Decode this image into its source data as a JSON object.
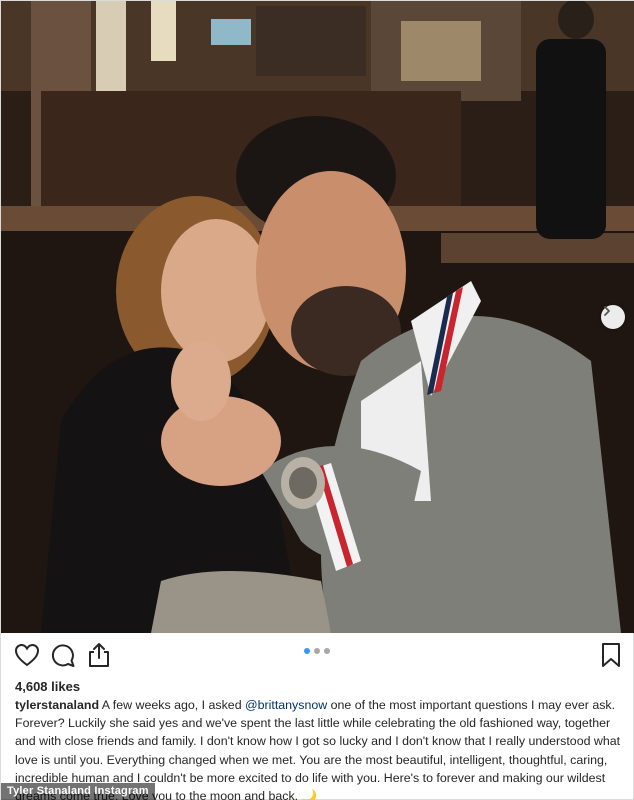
{
  "post": {
    "photo": {
      "alt_subjects": "couple embracing in restaurant booth"
    },
    "carousel": {
      "total": 3,
      "active_index": 0
    },
    "likes_text": "4,608 likes",
    "caption": {
      "username": "tylerstanaland",
      "text_before_mention": " A few weeks ago, I asked ",
      "mention": "@brittanysnow",
      "text_after_mention": " one of the most important questions I may ever ask. Forever? Luckily she said yes and we've spent the last little while celebrating the old fashioned way, together and with close friends and family. I don't know how I got so lucky and I don't know that I really understood what love is until you. Everything changed when we met. You are the most beautiful, intelligent, thoughtful, caring, incredible human and I couldn't be more excited to do life with you. Here's to forever and making our wildest dreams come true. Love you to the moon and back. 🌙"
    },
    "credit": "Tyler Stanaland Instagram"
  },
  "icons": {
    "like": "heart-icon",
    "comment": "comment-icon",
    "share": "share-icon",
    "save": "bookmark-icon",
    "next": "chevron-right-icon"
  },
  "colors": {
    "accent": "#3897f0",
    "mention": "#003569",
    "text": "#262626"
  }
}
